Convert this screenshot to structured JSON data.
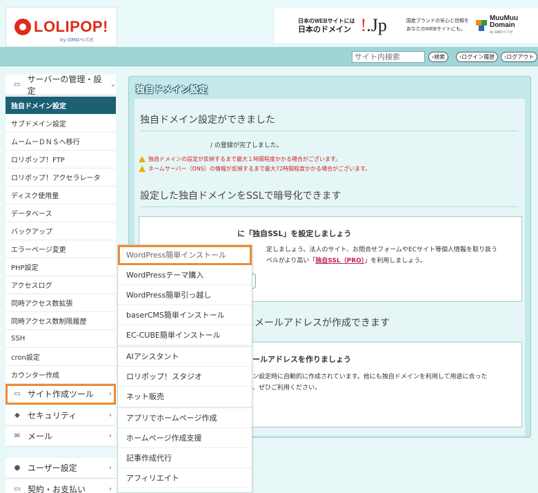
{
  "header": {
    "logo_text": "LOLIPOP!",
    "logo_sub": "by GMOペパボ",
    "banner": {
      "line1": "日本のWEBサイトには",
      "line2": "日本のドメイン",
      "jp": ".Jp",
      "right1": "国産ブランドの安心と信頼を",
      "right2": "あなたのWEBサイトにも。",
      "mm1": "MuuMuu",
      "mm2": "Domain",
      "mm3": "by GMOペパボ"
    }
  },
  "toolbar": {
    "search_placeholder": "サイト内検索",
    "search_btn": "検索",
    "history_btn": "ログイン履歴",
    "logout_btn": "ログアウト"
  },
  "sidebar": {
    "server_head": "サーバーの管理・設定",
    "items": [
      "独自ドメイン設定",
      "サブドメイン設定",
      "ムームーＤＮＳへ移行",
      "ロリポップ！FTP",
      "ロリポップ！アクセラレータ",
      "ディスク使用量",
      "データベース",
      "バックアップ",
      "エラーページ変更",
      "PHP設定",
      "アクセスログ",
      "同時アクセス数拡張",
      "同時アクセス数制限履歴",
      "SSH",
      "cron設定",
      "カウンター作成"
    ],
    "site_tools": "サイト作成ツール",
    "security": "セキュリティ",
    "mail": "メール",
    "user_settings": "ユーザー設定",
    "billing": "契約・お支払い"
  },
  "main": {
    "panel_title": "独自ドメイン設定",
    "heading1": "独自ドメイン設定ができました",
    "done_text": "/ の登録が完了しました。",
    "warn1": "独自ドメインの設定が反映するまで最大１時間程度かかる場合がございます。",
    "warn2": "ネームサーバー（DNS）の情報が反映するまで最大72時間程度かかる場合がございます。",
    "heading2": "設定した独自ドメインをSSLで暗号化できます",
    "ssl_title": "に「独自SSL」を設定しましょう",
    "ssl_desc1": "定しましょう。法人のサイト、お問合せフォームやECサイト等個人情報を取り扱う",
    "ssl_desc2_pre": "ベルがより高い「",
    "ssl_desc2_pro": "独自SSL（PRO）",
    "ssl_desc2_post": "」を利用しましょう。",
    "mail_head": "メールアドレスが作成できます",
    "mail_title": "ールアドレスを作りましょう",
    "mail_desc1": "ン設定時に自動的に作成されています。他にも独自ドメインを利用して用途に合った",
    "mail_desc2": "、ぜひご利用ください。"
  },
  "dropdown": {
    "items": [
      "WordPress簡単インストール",
      "WordPressテーマ購入",
      "WordPress簡単引っ越し",
      "baserCMS簡単インストール",
      "EC-CUBE簡単インストール",
      "AIアシスタント",
      "ロリポップ！スタジオ",
      "ネット販売",
      "アプリでホームページ作成",
      "ホームページ作成支援",
      "記事作成代行",
      "アフィリエイト"
    ]
  },
  "colors": {
    "accent_orange": "#f08a33",
    "active_nav": "#1d5f75",
    "brand_red": "#e02a1a",
    "warning_red": "#d02020"
  }
}
